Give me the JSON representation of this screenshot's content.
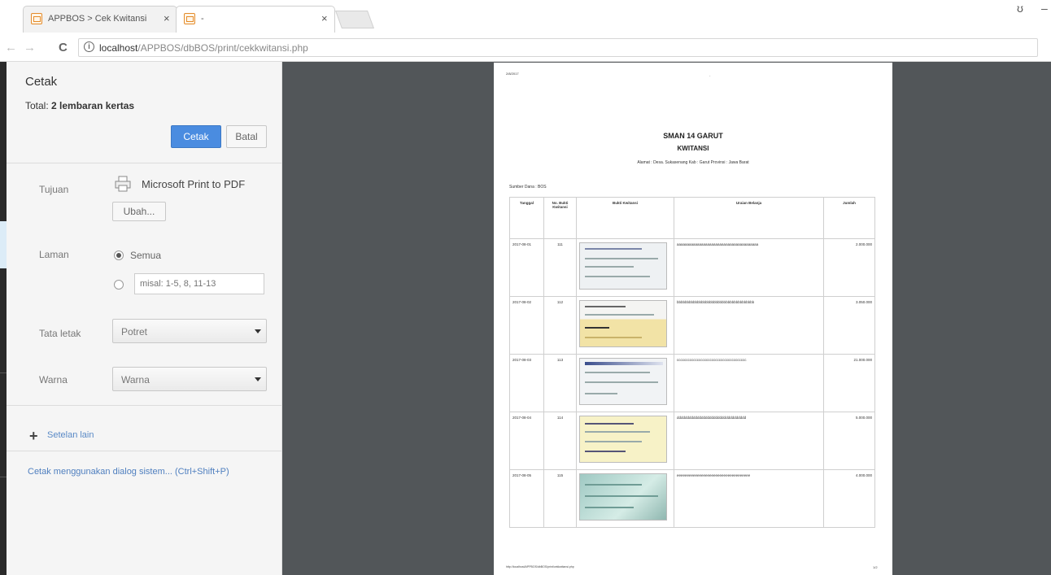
{
  "tabs": [
    {
      "label": "APPBOS > Cek Kwitansi",
      "active": false
    },
    {
      "label": "-",
      "active": true
    }
  ],
  "address_bar": {
    "url_host": "localhost",
    "url_path": "/APPBOS/dbBOS/print/cekkwitansi.php"
  },
  "print_panel": {
    "title": "Cetak",
    "total_prefix": "Total:",
    "total_value": "2 lembaran kertas",
    "print_button": "Cetak",
    "cancel_button": "Batal",
    "destination_label": "Tujuan",
    "destination_name": "Microsoft Print to PDF",
    "change_button": "Ubah...",
    "pages_label": "Laman",
    "pages_all": "Semua",
    "pages_placeholder": "misal: 1-5, 8, 11-13",
    "layout_label": "Tata letak",
    "layout_value": "Potret",
    "color_label": "Warna",
    "color_value": "Warna",
    "more_settings": "Setelan lain",
    "system_dialog": "Cetak menggunakan dialog sistem... (Ctrl+Shift+P)"
  },
  "preview": {
    "date": "2/8/2017",
    "school": "SMAN 14 GARUT",
    "doc_title": "KWITANSI",
    "address": "Alamat : Desa. Sukasenang Kab : Garut Provinsi : Jawa Barat",
    "fund_source": "Sumber Dana : BOS",
    "columns": [
      "Tanggal",
      "No. Bukti Kwitansi",
      "Bukti Kwitansi",
      "Uraian Belanja",
      "Jumlah"
    ],
    "rows": [
      {
        "date": "2017-08-01",
        "no": "111",
        "desc": "aaaaaaaaaaaaaaaaaaaaaaaaaaaaaaaaaaaaaaaa",
        "amount": "2.000.000"
      },
      {
        "date": "2017-08-02",
        "no": "112",
        "desc": "bbbbbbbbbbbbbbbbbbbbbbbbbbbbbbbbbbbbbb",
        "amount": "3.050.000"
      },
      {
        "date": "2017-08-03",
        "no": "113",
        "desc": "cccccccccccccccccccccccccccccccccccccc",
        "amount": "21.000.000"
      },
      {
        "date": "2017-08-04",
        "no": "114",
        "desc": "dddddddddddddddddddddddddddddddddd",
        "amount": "5.000.000"
      },
      {
        "date": "2017-08-05",
        "no": "115",
        "desc": "eeeeeeeeeeeeeeeeeeeeeeeeeeeeeeeeeeee",
        "amount": "4.000.000"
      }
    ],
    "footer_url": "http://localhost/APPBOS/dbBOS/print/cekkwitansi.php",
    "footer_page": "1/2"
  }
}
